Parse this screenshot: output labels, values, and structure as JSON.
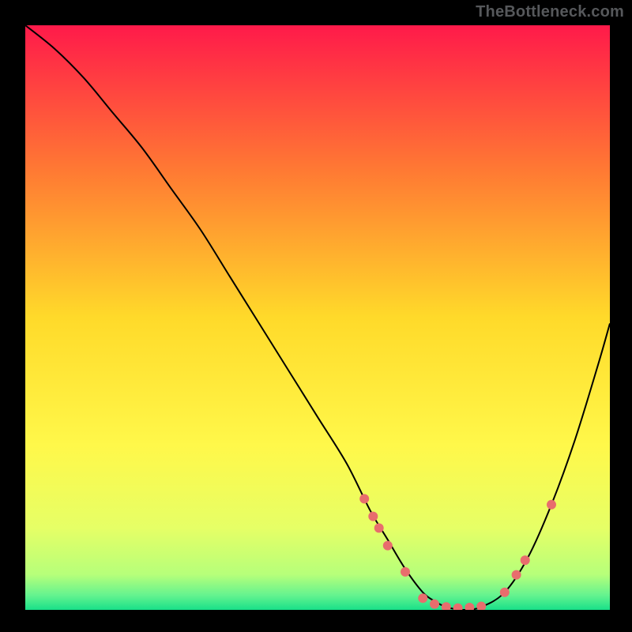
{
  "watermark": "TheBottleneck.com",
  "chart_data": {
    "type": "line",
    "title": "",
    "xlabel": "",
    "ylabel": "",
    "xlim": [
      0,
      100
    ],
    "ylim": [
      0,
      100
    ],
    "grid": false,
    "legend": false,
    "background_gradient": {
      "stops": [
        {
          "offset": 0.0,
          "color": "#ff1a4a"
        },
        {
          "offset": 0.25,
          "color": "#ff7a33"
        },
        {
          "offset": 0.5,
          "color": "#ffda2a"
        },
        {
          "offset": 0.72,
          "color": "#fff84a"
        },
        {
          "offset": 0.86,
          "color": "#e6ff66"
        },
        {
          "offset": 0.94,
          "color": "#b6ff7a"
        },
        {
          "offset": 0.975,
          "color": "#64f38f"
        },
        {
          "offset": 1.0,
          "color": "#19e089"
        }
      ]
    },
    "series": [
      {
        "name": "curve",
        "type": "line",
        "stroke": "#000000",
        "stroke_width": 2,
        "x": [
          0,
          5,
          10,
          15,
          20,
          25,
          30,
          35,
          40,
          45,
          50,
          55,
          59,
          62,
          65,
          68,
          70,
          72,
          75,
          78,
          82,
          86,
          90,
          94,
          98,
          100
        ],
        "y": [
          100,
          96,
          91,
          85,
          79,
          72,
          65,
          57,
          49,
          41,
          33,
          25,
          17,
          12,
          7,
          3,
          1.5,
          0.5,
          0,
          0.5,
          3,
          9,
          18,
          29,
          42,
          49
        ]
      },
      {
        "name": "markers",
        "type": "scatter",
        "fill": "#e86d6d",
        "radius": 6,
        "points": [
          {
            "x": 58.0,
            "y": 19.0
          },
          {
            "x": 59.5,
            "y": 16.0
          },
          {
            "x": 60.5,
            "y": 14.0
          },
          {
            "x": 62.0,
            "y": 11.0
          },
          {
            "x": 65.0,
            "y": 6.5
          },
          {
            "x": 68.0,
            "y": 2.0
          },
          {
            "x": 70.0,
            "y": 1.0
          },
          {
            "x": 72.0,
            "y": 0.5
          },
          {
            "x": 74.0,
            "y": 0.3
          },
          {
            "x": 76.0,
            "y": 0.4
          },
          {
            "x": 78.0,
            "y": 0.6
          },
          {
            "x": 82.0,
            "y": 3.0
          },
          {
            "x": 84.0,
            "y": 6.0
          },
          {
            "x": 85.5,
            "y": 8.5
          },
          {
            "x": 90.0,
            "y": 18.0
          }
        ]
      }
    ]
  }
}
